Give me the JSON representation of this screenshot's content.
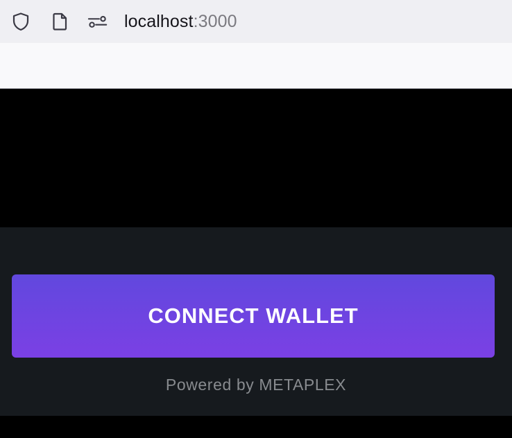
{
  "browser": {
    "url_host": "localhost",
    "url_port": ":3000",
    "icons": [
      "shield-icon",
      "page-icon",
      "permissions-icon"
    ]
  },
  "app": {
    "connect_label": "CONNECT WALLET",
    "powered_by": "Powered by METAPLEX",
    "colors": {
      "panel_bg": "#161a1e",
      "button_gradient_top": "#6148de",
      "button_gradient_bottom": "#7b40e4",
      "powered_text": "#888b8f"
    }
  }
}
